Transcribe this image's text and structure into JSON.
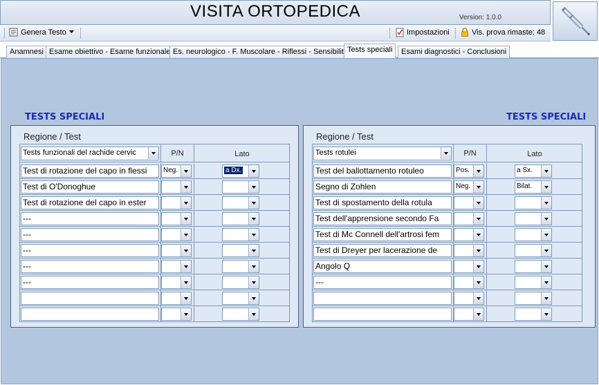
{
  "app": {
    "title": "VISITA ORTOPEDICA",
    "version": "Version: 1.0.0"
  },
  "toolbar": {
    "genera_testo": "Genera Testo",
    "impostazioni": "Impostazioni",
    "trial": "Vis. prova rimaste: 48"
  },
  "tabs": [
    {
      "label": "Anamnesi"
    },
    {
      "label": "Esame obiettivo - Esame funzionale"
    },
    {
      "label": "Es. neurologico - F. Muscolare - Riflessi - Sensibilità"
    },
    {
      "label": "Tests speciali"
    },
    {
      "label": "Esami diagnostici - Conclusioni"
    }
  ],
  "left": {
    "section_title": "TESTS SPECIALI",
    "panel_label": "Regione / Test",
    "region_value": "Tests funzionali del rachide cervic",
    "col_pn": "P/N",
    "col_lato": "Lato",
    "rows": [
      {
        "test": "Test di rotazione del capo in flessi",
        "pn": "Neg.",
        "lato": "a Dx."
      },
      {
        "test": "Test di O'Donoghue",
        "pn": "",
        "lato": ""
      },
      {
        "test": "Test di rotazione del capo in ester",
        "pn": "",
        "lato": ""
      },
      {
        "test": "---",
        "pn": "",
        "lato": ""
      },
      {
        "test": "---",
        "pn": "",
        "lato": ""
      },
      {
        "test": "---",
        "pn": "",
        "lato": ""
      },
      {
        "test": "---",
        "pn": "",
        "lato": ""
      },
      {
        "test": "---",
        "pn": "",
        "lato": ""
      },
      {
        "test": "",
        "pn": "",
        "lato": ""
      },
      {
        "test": "",
        "pn": "",
        "lato": ""
      }
    ]
  },
  "right": {
    "section_title": "TESTS SPECIALI",
    "panel_label": "Regione / Test",
    "region_value": "Tests rotulei",
    "col_pn": "P/N",
    "col_lato": "Lato",
    "rows": [
      {
        "test": "Test del ballottamento rotuleo",
        "pn": "Pos.",
        "lato": "a Sx."
      },
      {
        "test": "Segno di Zohlen",
        "pn": "Neg.",
        "lato": "Bilat."
      },
      {
        "test": "Test di spostamento della rotula",
        "pn": "",
        "lato": ""
      },
      {
        "test": "Test dell'apprensione secondo Fa",
        "pn": "",
        "lato": ""
      },
      {
        "test": "Test di Mc Connell dell'artrosi fem",
        "pn": "",
        "lato": ""
      },
      {
        "test": "Test di Dreyer per lacerazione de",
        "pn": "",
        "lato": ""
      },
      {
        "test": "Angolo Q",
        "pn": "",
        "lato": ""
      },
      {
        "test": "---",
        "pn": "",
        "lato": ""
      },
      {
        "test": "",
        "pn": "",
        "lato": ""
      },
      {
        "test": "",
        "pn": "",
        "lato": ""
      }
    ]
  },
  "icons": {
    "logo": "crutch-icon",
    "genera_testo": "document-icon",
    "impostazioni": "checklist-icon",
    "trial": "lock-icon"
  }
}
